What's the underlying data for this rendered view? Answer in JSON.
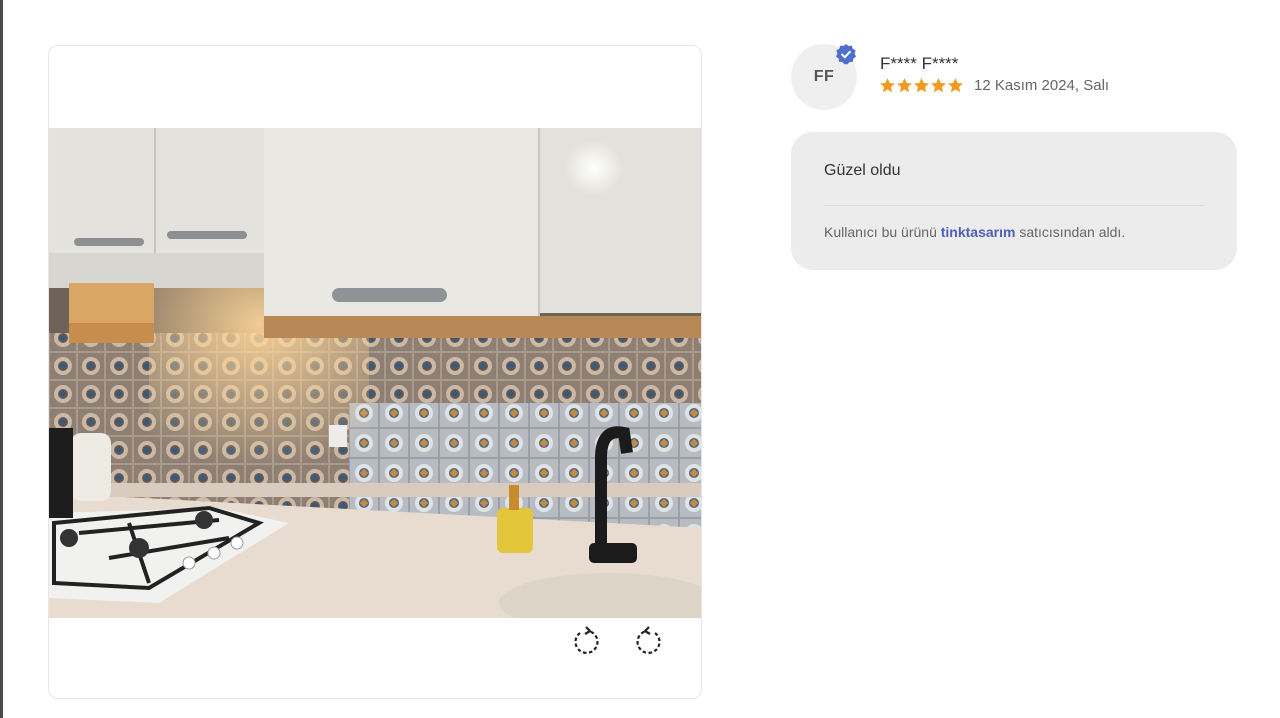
{
  "review": {
    "avatar_initials": "FF",
    "user_name": "F**** F****",
    "rating": 5,
    "rating_max": 5,
    "date": "12 Kasım 2024, Salı",
    "comment": "Güzel oldu",
    "seller_prefix": "Kullanıcı bu ürünü",
    "seller_name": "tinktasarım",
    "seller_suffix": "satıcısından aldı."
  },
  "image_viewer": {
    "photo_icon": "kitchen-photo",
    "rotate_left_icon": "rotate-left-icon",
    "rotate_right_icon": "rotate-right-icon"
  },
  "colors": {
    "star": "#f29a1f",
    "verified_badge": "#4f6fd0",
    "seller_link": "#4f5fb6",
    "comment_bg": "#ececec"
  }
}
